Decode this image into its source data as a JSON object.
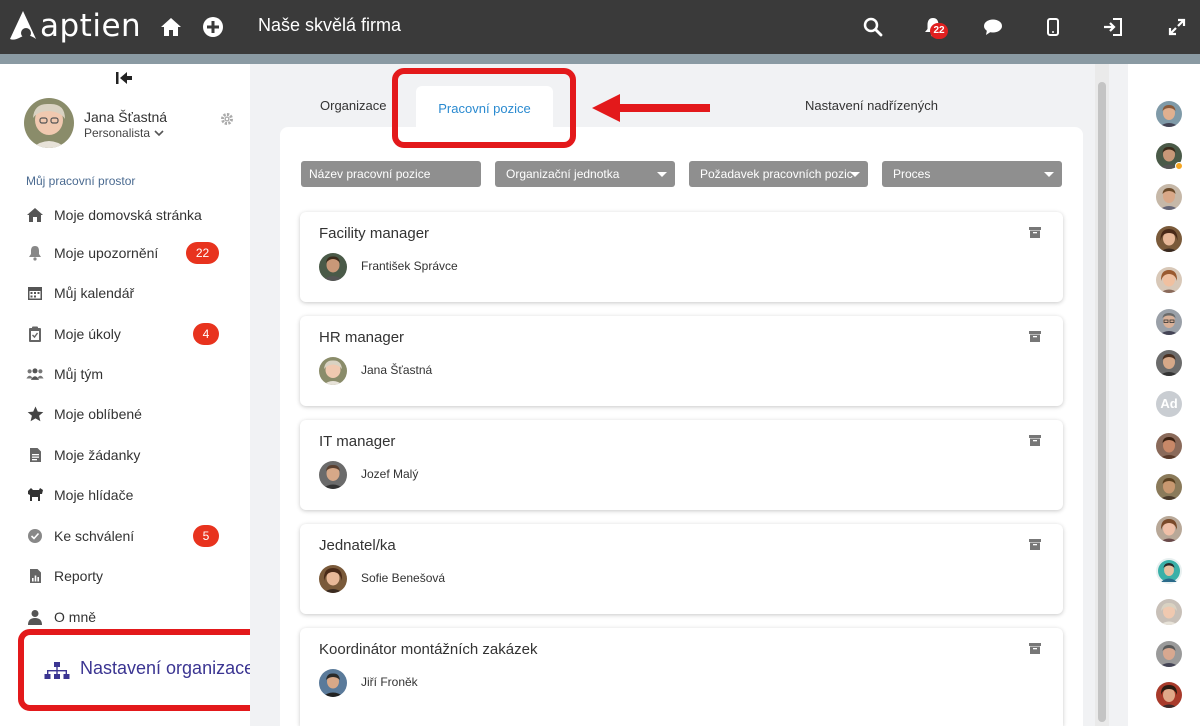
{
  "brand": {
    "logo_text": "aptien"
  },
  "header": {
    "app_title": "Naše skvělá firma",
    "notifications_count": "22"
  },
  "profile": {
    "name": "Jana Šťastná",
    "role": "Personalista"
  },
  "sidebar": {
    "section_label": "Můj pracovní prostor",
    "items": [
      {
        "label": "Moje domovská stránka",
        "icon": "home-icon"
      },
      {
        "label": "Moje upozornění",
        "icon": "bell-icon",
        "badge": "22"
      },
      {
        "label": "Můj kalendář",
        "icon": "calendar-icon"
      },
      {
        "label": "Moje úkoly",
        "icon": "clipboard-icon",
        "badge": "4"
      },
      {
        "label": "Můj tým",
        "icon": "team-icon"
      },
      {
        "label": "Moje oblíbené",
        "icon": "star-icon"
      },
      {
        "label": "Moje žádanky",
        "icon": "document-icon"
      },
      {
        "label": "Moje hlídače",
        "icon": "dog-icon"
      },
      {
        "label": "Ke schválení",
        "icon": "check-circle-icon",
        "badge": "5"
      },
      {
        "label": "Reporty",
        "icon": "report-icon"
      },
      {
        "label": "O mně",
        "icon": "user-icon"
      }
    ],
    "org_settings_label": "Nastavení organizace"
  },
  "tabs": {
    "organizace": "Organizace",
    "pracovni_pozice": "Pracovní pozice",
    "nastaveni_nadrizenych": "Nastavení nadřízených"
  },
  "filters": {
    "position_name": "Název pracovní pozice",
    "org_unit": "Organizační jednotka",
    "position_request": "Požadavek pracovních pozic",
    "process": "Proces"
  },
  "positions": [
    {
      "title": "Facility manager",
      "person": "František Správce"
    },
    {
      "title": "HR manager",
      "person": "Jana Šťastná"
    },
    {
      "title": "IT manager",
      "person": "Jozef Malý"
    },
    {
      "title": "Jednatel/ka",
      "person": "Sofie Benešová"
    },
    {
      "title": "Koordinátor montážních zakázek",
      "person": "Jiří Froněk"
    }
  ],
  "right_bar": {
    "ad_initials": "Ad"
  },
  "colors": {
    "topbar": "#3a3a3a",
    "accent_red": "#e3191b",
    "active_tab": "#2a8ad0",
    "badge_red": "#e8331e",
    "org_label": "#3b3592"
  }
}
